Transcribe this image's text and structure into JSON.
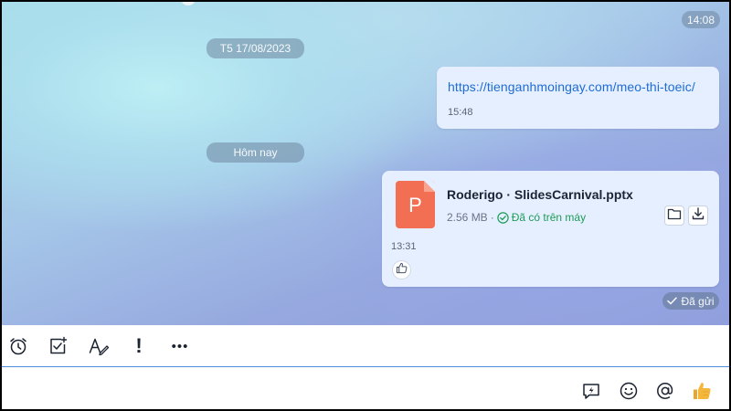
{
  "header": {
    "time": "14:08"
  },
  "messages": {
    "date_separator": "T5 17/08/2023",
    "link_message": {
      "url_text": "https://tienganhmoingay.com/meo-thi-toeic/",
      "time": "15:48"
    },
    "today_separator": "Hôm nay",
    "file_message": {
      "file_icon_letter": "P",
      "file_name": "Roderigo · SlidesCarnival.pptx",
      "file_size": "2.56 MB",
      "meta_separator": "·",
      "status": "Đã có trên máy",
      "time": "13:31"
    },
    "sent_status": "Đã gửi"
  },
  "toolbar": {
    "icons": [
      "alarm-clock-icon",
      "task-checkbox-icon",
      "text-format-icon",
      "exclamation-icon",
      "more-icon"
    ],
    "exclamation_label": "!",
    "more_label": "•••"
  },
  "compose": {
    "input_value": "",
    "icons": [
      "quick-message-icon",
      "emoji-icon",
      "mention-icon",
      "thumbs-up-icon"
    ]
  },
  "colors": {
    "bubble": "#e5efff",
    "link": "#1f6cd6",
    "file_icon": "#f36f54",
    "status_green": "#1e9c55",
    "toolbar_border": "#4a8fe0",
    "thumbs_up": "#f5b73b"
  }
}
